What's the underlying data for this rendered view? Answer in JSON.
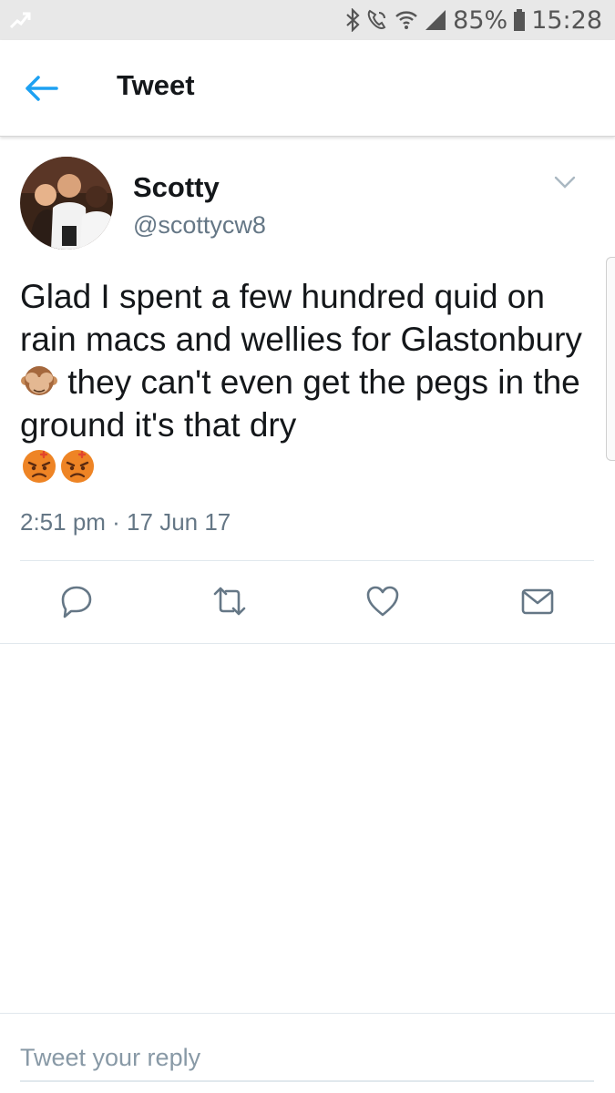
{
  "status_bar": {
    "battery": "85%",
    "time": "15:28"
  },
  "header": {
    "title": "Tweet"
  },
  "tweet": {
    "author_name": "Scotty",
    "author_handle": "@scottycw8",
    "text_part1": "Glad I spent a few hundred quid on rain macs and wellies for Glastonbury",
    "text_part2": " they can't even get the pegs in the ground it's that dry",
    "timestamp": "2:51 pm · 17 Jun 17"
  },
  "icons": {
    "back": "arrow-left-icon",
    "caret": "chevron-down-icon",
    "reply": "reply-icon",
    "retweet": "retweet-icon",
    "like": "heart-icon",
    "dm": "envelope-icon",
    "emoji_monkey": "see-no-evil-monkey-emoji",
    "emoji_angry": "angry-face-emoji"
  },
  "colors": {
    "accent": "#1da1f2",
    "secondary_text": "#657786",
    "icon_gray": "#657786"
  },
  "reply": {
    "placeholder": "Tweet your reply"
  }
}
